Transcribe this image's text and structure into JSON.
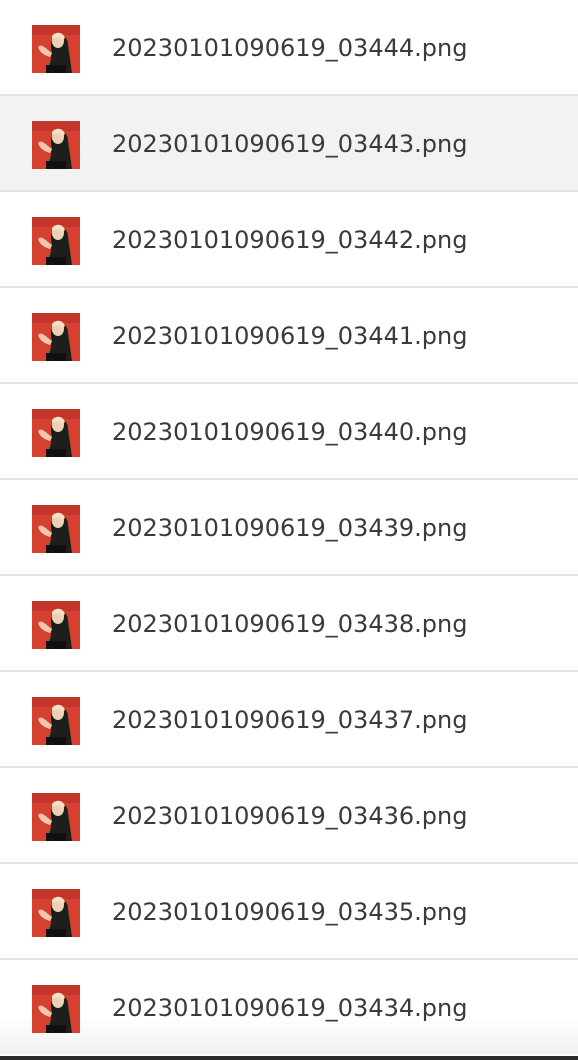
{
  "files": [
    {
      "name": "20230101090619_03444.png",
      "thumbnail": "image-thumbnail-icon"
    },
    {
      "name": "20230101090619_03443.png",
      "thumbnail": "image-thumbnail-icon"
    },
    {
      "name": "20230101090619_03442.png",
      "thumbnail": "image-thumbnail-icon"
    },
    {
      "name": "20230101090619_03441.png",
      "thumbnail": "image-thumbnail-icon"
    },
    {
      "name": "20230101090619_03440.png",
      "thumbnail": "image-thumbnail-icon"
    },
    {
      "name": "20230101090619_03439.png",
      "thumbnail": "image-thumbnail-icon"
    },
    {
      "name": "20230101090619_03438.png",
      "thumbnail": "image-thumbnail-icon"
    },
    {
      "name": "20230101090619_03437.png",
      "thumbnail": "image-thumbnail-icon"
    },
    {
      "name": "20230101090619_03436.png",
      "thumbnail": "image-thumbnail-icon"
    },
    {
      "name": "20230101090619_03435.png",
      "thumbnail": "image-thumbnail-icon"
    },
    {
      "name": "20230101090619_03434.png",
      "thumbnail": "image-thumbnail-icon"
    }
  ],
  "colors": {
    "thumbnail_background": "#d6402f",
    "selected_row": "#f2f2f2",
    "divider": "#e3e3e3",
    "text": "#3a3a3a"
  }
}
